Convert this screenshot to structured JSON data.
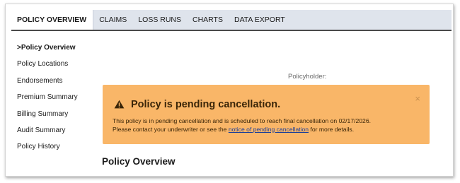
{
  "tabs": [
    {
      "label": "POLICY OVERVIEW",
      "active": true
    },
    {
      "label": "CLAIMS",
      "active": false
    },
    {
      "label": "LOSS RUNS",
      "active": false
    },
    {
      "label": "CHARTS",
      "active": false
    },
    {
      "label": "DATA EXPORT",
      "active": false
    }
  ],
  "sidebar": {
    "items": [
      {
        "label": ">Policy Overview",
        "active": true
      },
      {
        "label": "Policy Locations",
        "active": false
      },
      {
        "label": "Endorsements",
        "active": false
      },
      {
        "label": "Premium Summary",
        "active": false
      },
      {
        "label": "Billing Summary",
        "active": false
      },
      {
        "label": "Audit Summary",
        "active": false
      },
      {
        "label": "Policy History",
        "active": false
      }
    ]
  },
  "policyholder_label": "Policyholder:",
  "alert": {
    "icon": "warning-icon",
    "title": "Policy is pending cancellation.",
    "close_glyph": "×",
    "line1": "This policy is in pending cancellation and is scheduled to reach final cancellation on 02/17/2026.",
    "line2_before": "Please contact your underwriter or see the ",
    "link_text": "notice of pending cancellation",
    "line2_after": " for more details.",
    "background_color": "#f9b668",
    "link_color": "#1d3f99"
  },
  "section_heading": "Policy Overview"
}
